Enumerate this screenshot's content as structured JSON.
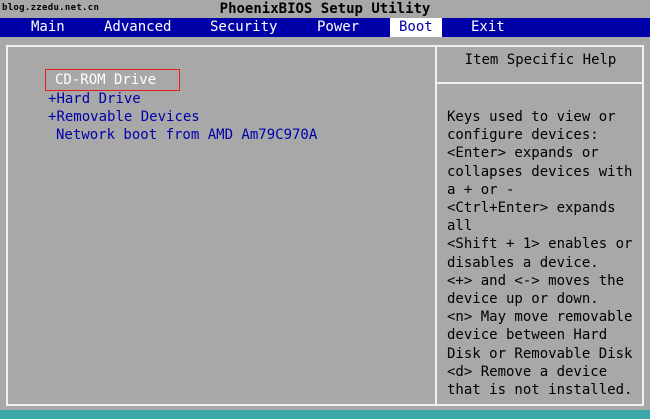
{
  "header": {
    "watermark": "blog.zzedu.net.cn",
    "title": "PhoenixBIOS Setup Utility"
  },
  "menu": {
    "items": [
      "Main",
      "Advanced",
      "Security",
      "Power",
      "Boot",
      "Exit"
    ],
    "active": "Boot"
  },
  "boot_list": {
    "items": [
      {
        "prefix": "",
        "label": "CD-ROM Drive"
      },
      {
        "prefix": "+",
        "label": "Hard Drive"
      },
      {
        "prefix": "+",
        "label": "Removable Devices"
      },
      {
        "prefix": "",
        "label": "Network boot from AMD Am79C970A"
      }
    ],
    "selected_index": 0
  },
  "help": {
    "title": "Item Specific Help",
    "text": "Keys used to view or\nconfigure devices:\n<Enter> expands or\ncollapses devices with\na + or -\n<Ctrl+Enter> expands\nall\n<Shift + 1> enables or\ndisables a device.\n<+> and <-> moves the\ndevice up or down.\n<n> May move removable\ndevice between Hard\nDisk or Removable Disk\n<d> Remove a device\nthat is not installed."
  },
  "colors": {
    "background": "#a8a8a8",
    "menu_bar": "#0000a8",
    "item_text": "#0000a8",
    "selected_text": "#ffffff",
    "selection_outline": "#e02020",
    "bottom_strip": "#3aa8a8"
  }
}
